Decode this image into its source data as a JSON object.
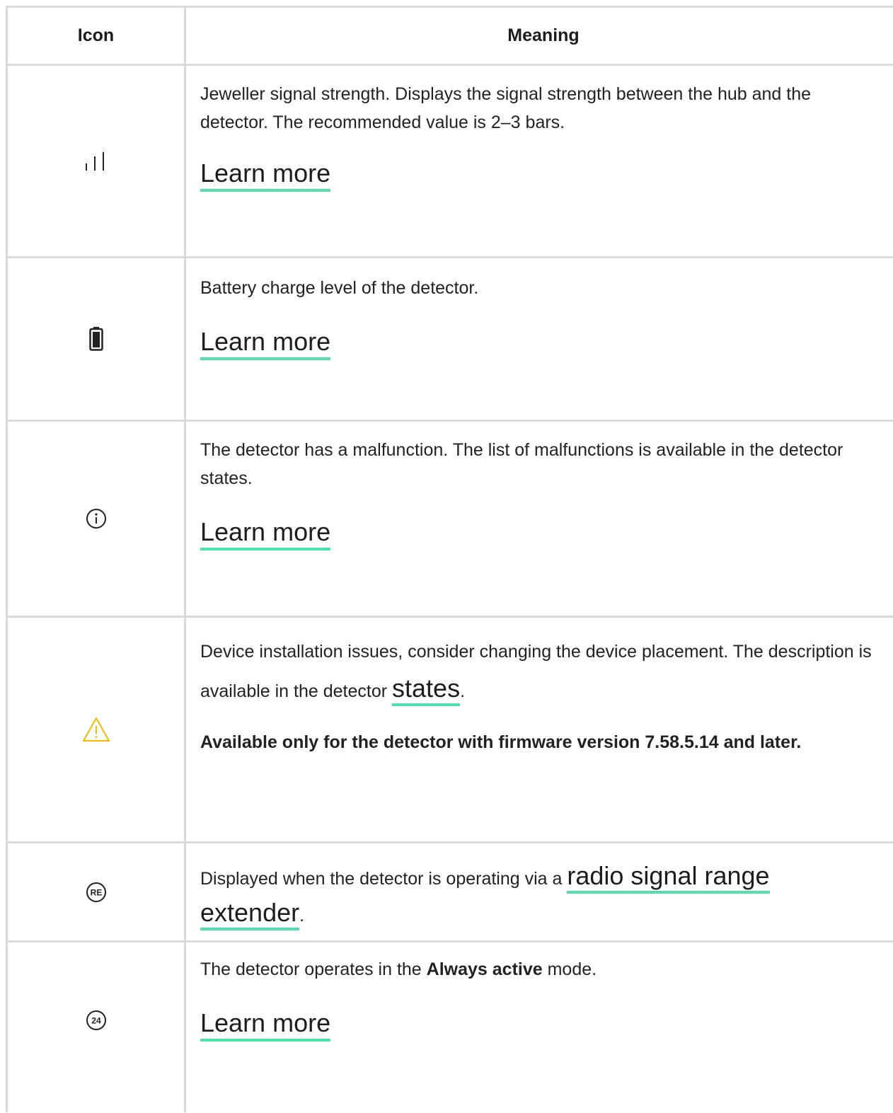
{
  "header": {
    "icon_col": "Icon",
    "meaning_col": "Meaning"
  },
  "rows": [
    {
      "icon": "signal-strength-icon",
      "text": "Jeweller signal strength. Displays the signal strength between the hub and the detector. The recommended value is 2–3 bars.",
      "link": "Learn more"
    },
    {
      "icon": "battery-icon",
      "text": "Battery charge level of the detector.",
      "link": "Learn more"
    },
    {
      "icon": "info-icon",
      "text": "The detector has a malfunction. The list of malfunctions is available in the detector states.",
      "link": "Learn more"
    },
    {
      "icon": "warning-icon",
      "text_before": "Device installation issues, consider changing the device placement. The description is available in the detector ",
      "inline_link": "states",
      "text_after": ".",
      "note": "Available only for the detector with firmware version 7.58.5.14 and later."
    },
    {
      "icon": "range-extender-icon",
      "icon_label": "RE",
      "text_before": "Displayed when the detector is operating via a ",
      "inline_link_1": "radio signal range",
      "inline_link_2": "extender",
      "text_after": "."
    },
    {
      "icon": "always-active-icon",
      "icon_label": "24",
      "text_before": "The detector operates in the ",
      "bold": "Always active",
      "text_after": " mode.",
      "link": "Learn more"
    }
  ],
  "colors": {
    "link_underline": "#4de0a8",
    "warning": "#f5b700",
    "border": "#d9d9d9"
  }
}
